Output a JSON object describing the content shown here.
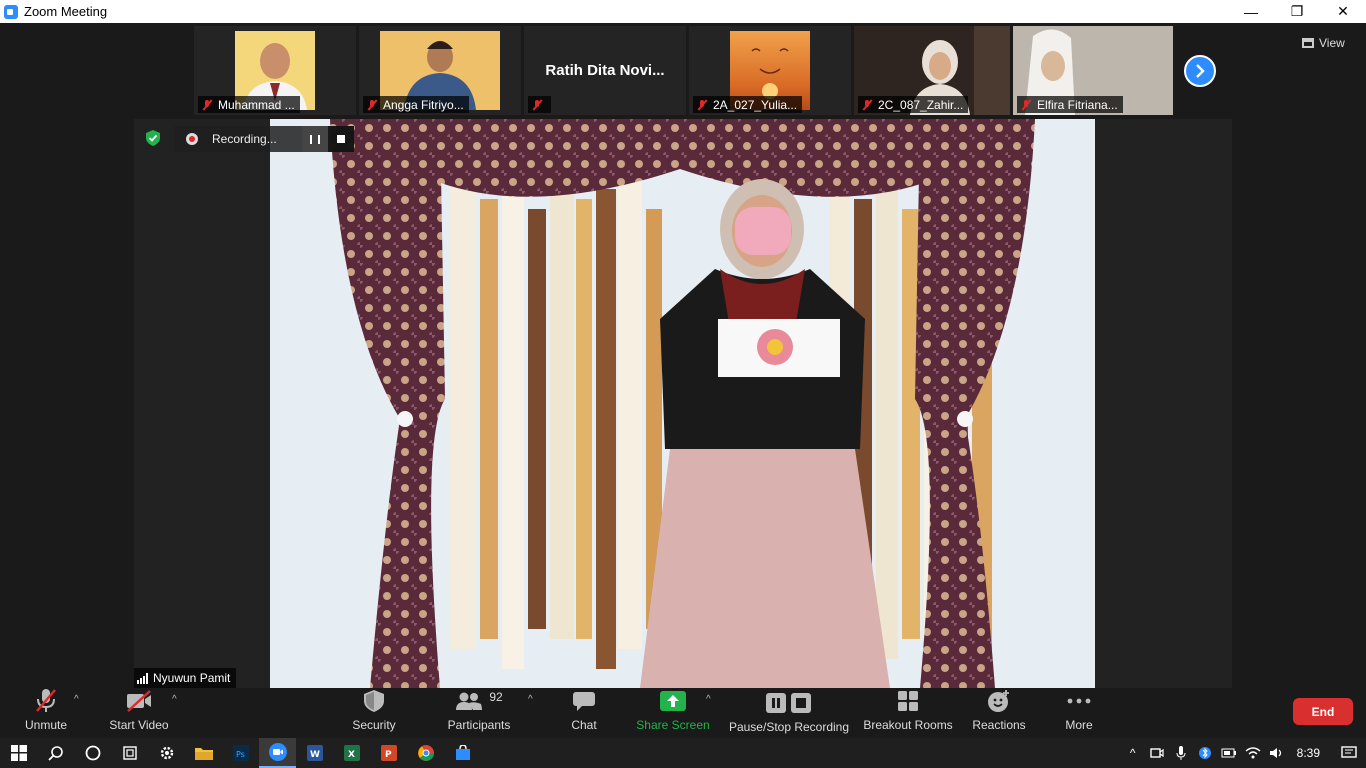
{
  "window": {
    "title": "Zoom Meeting",
    "controls": [
      "—",
      "❐",
      "✕"
    ]
  },
  "view_label": "View",
  "gallery": [
    {
      "name": "Muhammad ...",
      "kind": "video",
      "bg": "#f3d77a"
    },
    {
      "name": "Angga Fitriyo...",
      "kind": "video",
      "bg": "#f0c36a"
    },
    {
      "name": "",
      "display_name": "Ratih Dita Novi...",
      "kind": "text"
    },
    {
      "name": "2A_027_Yulia...",
      "kind": "video",
      "bg": "#e8823a"
    },
    {
      "name": "2C_087_Zahir...",
      "kind": "video",
      "bg": "#3a2a22"
    },
    {
      "name": "Elfira Fitriana...",
      "kind": "video",
      "bg": "#bdb7ae"
    }
  ],
  "recording": {
    "label": "Recording..."
  },
  "speaker": {
    "name": "Nyuwun Pamit"
  },
  "toolbar": {
    "unmute": "Unmute",
    "start_video": "Start Video",
    "security": "Security",
    "participants": "Participants",
    "participants_count": "92",
    "chat": "Chat",
    "share_screen": "Share Screen",
    "pause_stop_recording": "Pause/Stop Recording",
    "breakout_rooms": "Breakout Rooms",
    "reactions": "Reactions",
    "more": "More",
    "end": "End"
  },
  "colors": {
    "accent": "#2d8cff",
    "share_green": "#23b24b",
    "end_red": "#d92f2f",
    "mute_red": "#e02828"
  },
  "taskbar": {
    "apps": [
      "windows-start",
      "search",
      "cortana",
      "task-view",
      "settings",
      "file-explorer",
      "photoshop",
      "zoom",
      "word",
      "excel",
      "powerpoint",
      "chrome",
      "store"
    ],
    "time": "8:39"
  }
}
